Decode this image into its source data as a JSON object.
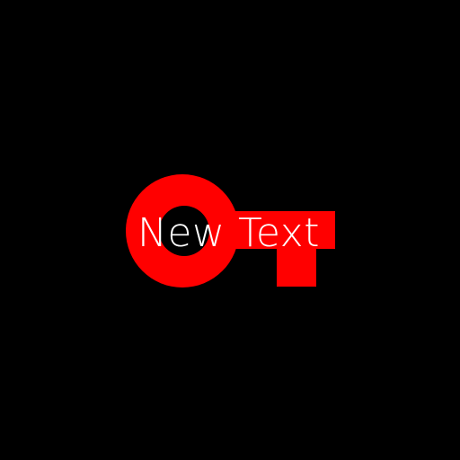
{
  "canvas": {
    "background_color": "#000000"
  },
  "key_icon": {
    "icon": "key-icon",
    "color": "#ff0000",
    "hole_color": "#000000"
  },
  "label": {
    "text": "New Text",
    "color": "#ffffff"
  }
}
